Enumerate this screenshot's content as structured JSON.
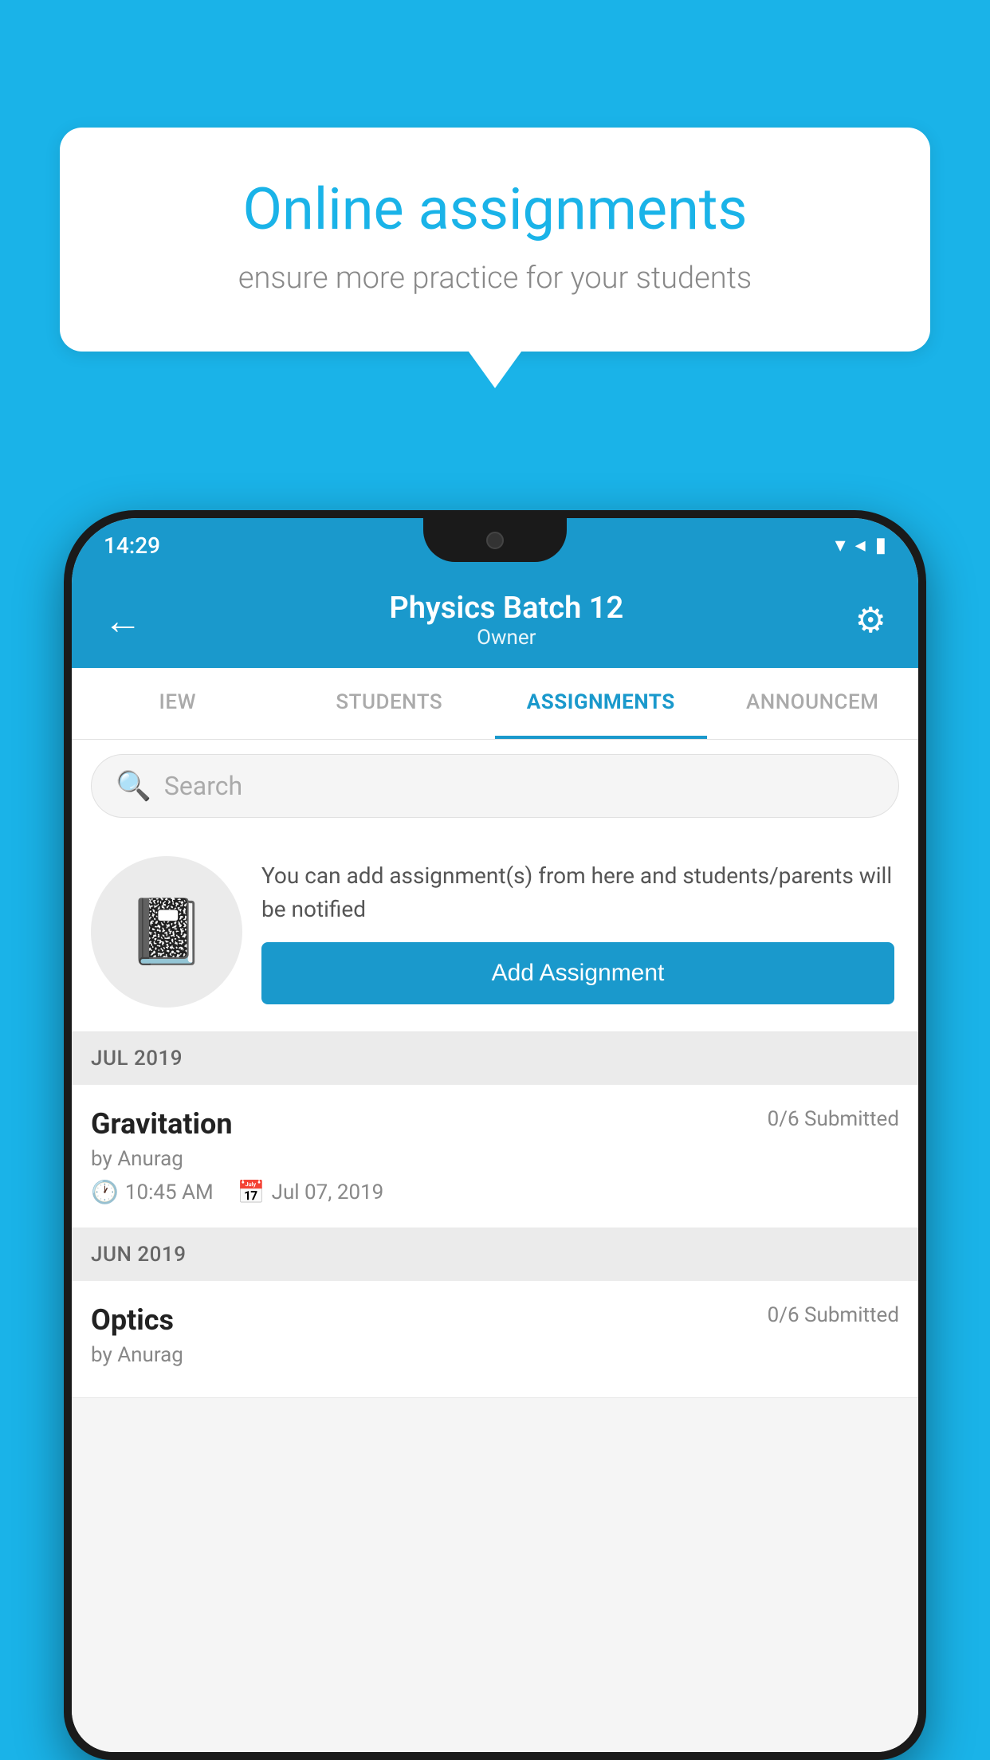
{
  "background_color": "#1ab3e8",
  "speech_bubble": {
    "title": "Online assignments",
    "subtitle": "ensure more practice for your students"
  },
  "phone": {
    "status_bar": {
      "time": "14:29",
      "icons": [
        "wifi",
        "signal",
        "battery"
      ]
    },
    "app_bar": {
      "title": "Physics Batch 12",
      "subtitle": "Owner",
      "back_label": "←",
      "settings_label": "⚙"
    },
    "tabs": [
      {
        "label": "IEW",
        "active": false
      },
      {
        "label": "STUDENTS",
        "active": false
      },
      {
        "label": "ASSIGNMENTS",
        "active": true
      },
      {
        "label": "ANNOUNCEM",
        "active": false
      }
    ],
    "search": {
      "placeholder": "Search"
    },
    "promo": {
      "description": "You can add assignment(s) from here and students/parents will be notified",
      "button_label": "Add Assignment"
    },
    "sections": [
      {
        "month_label": "JUL 2019",
        "assignments": [
          {
            "title": "Gravitation",
            "submitted": "0/6 Submitted",
            "author": "by Anurag",
            "time": "10:45 AM",
            "date": "Jul 07, 2019"
          }
        ]
      },
      {
        "month_label": "JUN 2019",
        "assignments": [
          {
            "title": "Optics",
            "submitted": "0/6 Submitted",
            "author": "by Anurag",
            "time": "",
            "date": ""
          }
        ]
      }
    ]
  }
}
